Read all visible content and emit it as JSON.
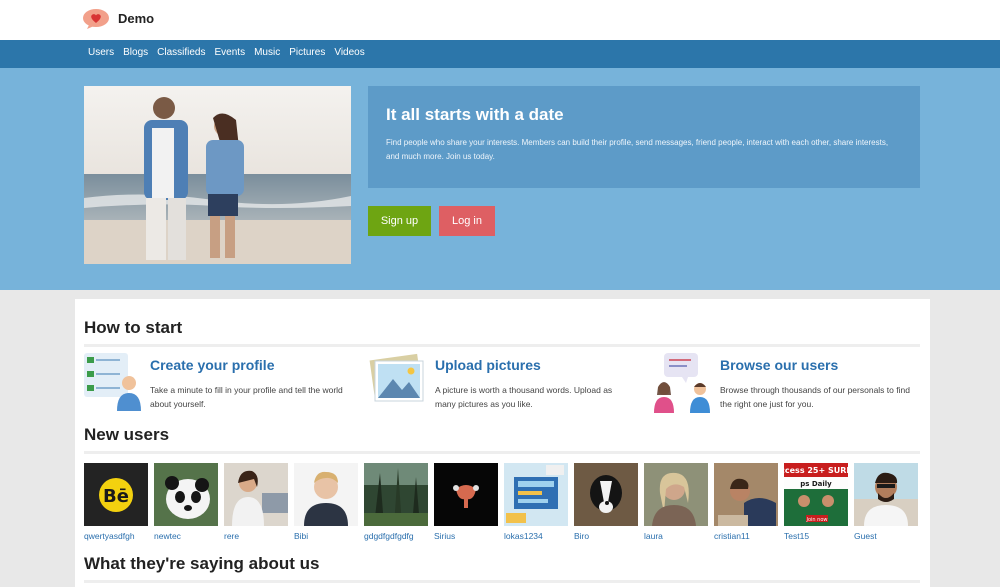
{
  "header": {
    "brand": "Demo"
  },
  "nav": {
    "items": [
      "Users",
      "Blogs",
      "Classifieds",
      "Events",
      "Music",
      "Pictures",
      "Videos"
    ]
  },
  "hero": {
    "title": "It all starts with a date",
    "text": "Find people who share your interests. Members can build their profile, send messages, friend people, interact with each other, share interests, and much more. Join us today.",
    "signup_label": "Sign up",
    "login_label": "Log in"
  },
  "how_to_start": {
    "title": "How to start",
    "features": [
      {
        "title": "Create your profile",
        "text": "Take a minute to fill in your profile and tell the world about yourself."
      },
      {
        "title": "Upload pictures",
        "text": "A picture is worth a thousand words. Upload as many pictures as you like."
      },
      {
        "title": "Browse our users",
        "text": "Browse through thousands of our personals to find the right one just for you."
      }
    ]
  },
  "new_users": {
    "title": "New users",
    "users": [
      "qwertyasdfgh",
      "newtec",
      "rere",
      "Bibi",
      "gdgdfgdfgdfg",
      "Sirius",
      "lokas1234",
      "Biro",
      "laura",
      "cristian11",
      "Test15",
      "Guest"
    ]
  },
  "testimonials": {
    "title": "What they're saying about us"
  },
  "colors": {
    "nav": "#2c76aa",
    "hero": "#77b3da",
    "signup": "#6ea512",
    "login": "#de5f63",
    "link": "#2a6fad"
  }
}
